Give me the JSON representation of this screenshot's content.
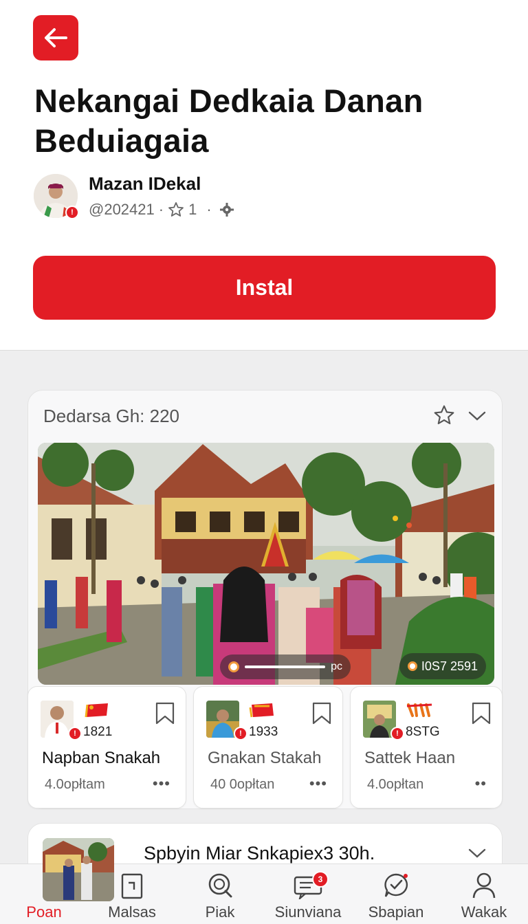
{
  "header": {
    "back_icon": "arrow-left-icon",
    "title": "Nekangai Dedkaia Danan Beduiagaia"
  },
  "author": {
    "name": "Mazan IDekal",
    "handle": "@202421",
    "separator": "·",
    "rating": "1",
    "avatar_badge": "!"
  },
  "install": {
    "label": "Instal"
  },
  "feed_card": {
    "heading": "Dedarsa Gh: 220",
    "media_time": "pc",
    "count": "I0S7 2591"
  },
  "sub_cards": [
    {
      "number": "1821",
      "name": "Napban Snakah",
      "meta": "4.0opłtam",
      "more": "•••",
      "badge": "!"
    },
    {
      "number": "1933",
      "name": "Gnakan Stakah",
      "meta": "40 0opłtan",
      "more": "•••",
      "badge": "!"
    },
    {
      "number": "8STG",
      "name": "Sattek Haan",
      "meta": "4.0opłtan",
      "more": "••",
      "badge": "!"
    }
  ],
  "next_card": {
    "text": "Spbyin Miar Snkapiex3 30h."
  },
  "bottom_nav": [
    {
      "label": "Poan",
      "icon": "thumbnail-icon"
    },
    {
      "label": "Malsas",
      "icon": "document-icon"
    },
    {
      "label": "Piak",
      "icon": "search-icon"
    },
    {
      "label": "Siunviana",
      "icon": "message-icon",
      "badge": "3"
    },
    {
      "label": "Sbapian",
      "icon": "chat-check-icon"
    },
    {
      "label": "Wakak",
      "icon": "person-icon"
    }
  ],
  "colors": {
    "accent": "#e21d25",
    "background": "#eeeeef"
  }
}
